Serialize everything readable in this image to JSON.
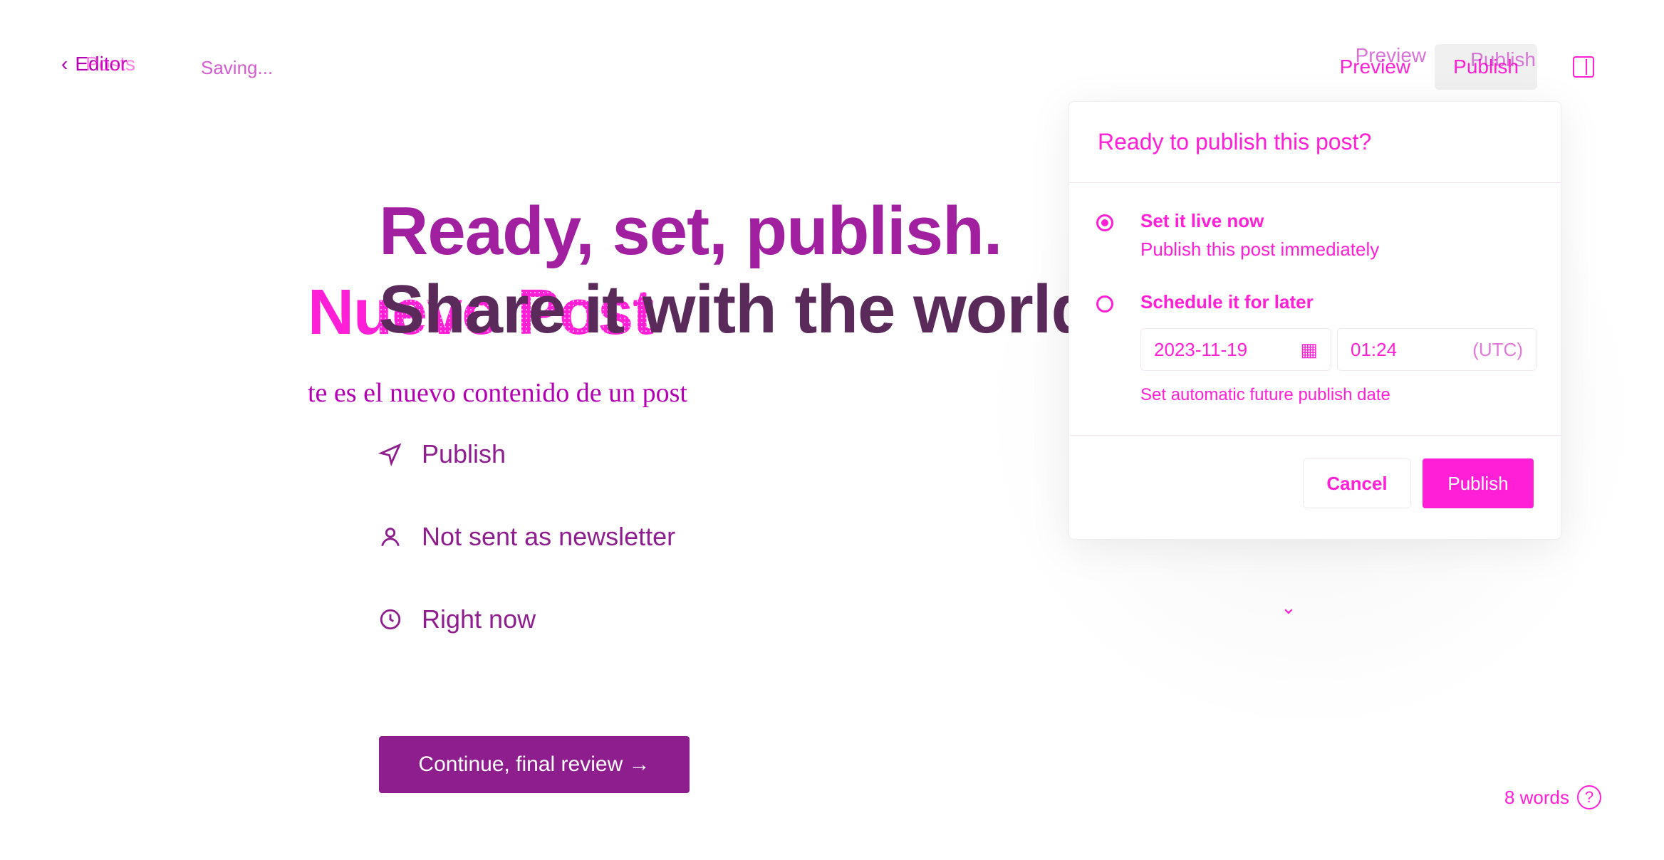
{
  "topbar": {
    "back_label": "Editor",
    "back_ghost": "Posts",
    "saving_status": "Saving...",
    "preview_label": "Preview",
    "preview_ghost": "Preview",
    "publish_label": "Publish",
    "publish_ghost": "Publish"
  },
  "editor_bg": {
    "post_title": "Nuevo Post",
    "post_content": "te es el nuevo contenido de un post"
  },
  "publish_flow": {
    "heading_line1": "Ready, set, publish.",
    "heading_line2": "Share it with the world.",
    "settings": [
      {
        "icon": "send-icon",
        "label": "Publish"
      },
      {
        "icon": "user-icon",
        "label": "Not sent as newsletter"
      },
      {
        "icon": "clock-icon",
        "label": "Right now"
      }
    ],
    "continue_label": "Continue, final review →"
  },
  "footer": {
    "word_count": "8 words",
    "help_icon": "help-icon"
  },
  "popover": {
    "title": "Ready to publish this post?",
    "option_now_label": "Set it live now",
    "option_now_sub": "Publish this post immediately",
    "option_later_label": "Schedule it for later",
    "date_value": "2023-11-19",
    "time_value": "01:24",
    "timezone": "(UTC)",
    "schedule_help": "Set automatic future publish date",
    "cancel_label": "Cancel",
    "publish_label": "Publish"
  },
  "colors": {
    "accent": "#ff1fd6",
    "ink": "#8b008b"
  }
}
